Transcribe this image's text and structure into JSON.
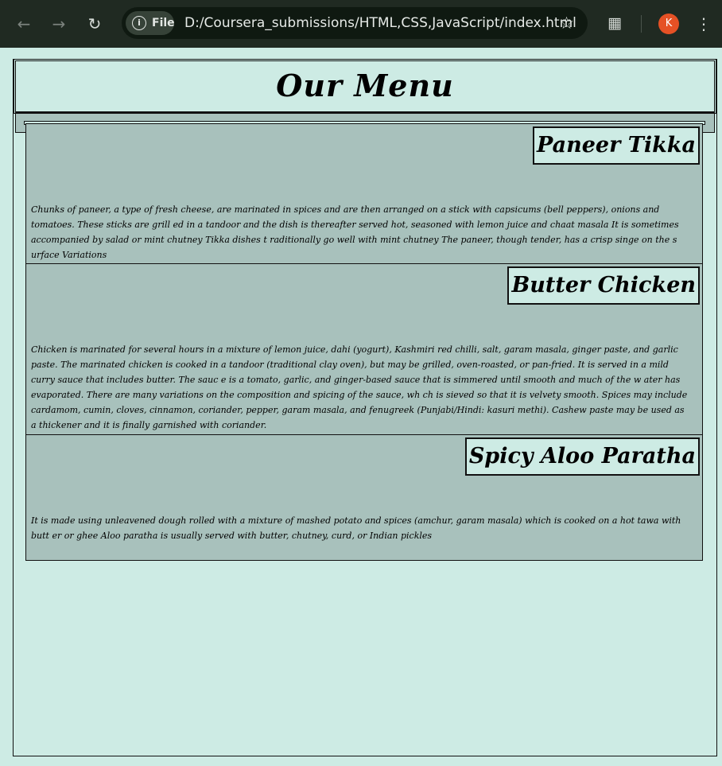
{
  "browser": {
    "back_icon": "arrow-left-icon",
    "forward_icon": "arrow-right-icon",
    "reload_icon": "reload-icon",
    "site_chip_label": "File",
    "url": "D:/Coursera_submissions/HTML,CSS,JavaScript/index.html",
    "bookmark_icon": "star-icon",
    "extensions_icon": "puzzle-icon",
    "profile_initial": "K",
    "menu_icon": "more-vert-icon",
    "profile_color": "#e55125"
  },
  "page": {
    "title": "Our Menu",
    "background": "#cdebe4",
    "item_background": "#a8c1bc"
  },
  "menu": {
    "items": [
      {
        "name": "Paneer Tikka",
        "description": "Chunks of paneer, a type of fresh cheese, are marinated in spices and are then arranged on a stick with capsicums (bell peppers), onions and tomatoes. These sticks are grill ed in a tandoor and the dish is thereafter served hot, seasoned with lemon juice and chaat masala It is sometimes accompanied by salad or mint chutney Tikka dishes t raditionally go well with mint chutney The paneer, though tender, has a crisp singe on the s urface Variations"
      },
      {
        "name": "Butter Chicken",
        "description": "Chicken is marinated for several hours in a mixture of lemon juice, dahi (yogurt), Kashmiri red chilli, salt, garam masala, ginger paste, and garlic paste. The marinated chicken is cooked in a tandoor (traditional clay oven), but may be grilled, oven-roasted, or pan-fried. It is served in a mild curry sauce that includes butter. The sauc e is a tomato, garlic, and ginger-based sauce that is simmered until smooth and much of the w ater has evaporated. There are many variations on the composition and spicing of the sauce, wh ch is sieved so that it is velvety smooth. Spices may include cardamom, cumin, cloves, cinnamon, coriander, pepper, garam masala, and fenugreek (Punjabi/Hindi: kasuri methi). Cashew paste may be used as a thickener and it is finally garnished with coriander."
      },
      {
        "name": "Spicy Aloo Paratha",
        "description": "It is made using unleavened dough rolled with a mixture of mashed potato and spices (amchur, garam masala) which is cooked on a hot tawa with butt er or ghee Aloo paratha is usually served with butter, chutney, curd, or Indian pickles"
      }
    ]
  }
}
